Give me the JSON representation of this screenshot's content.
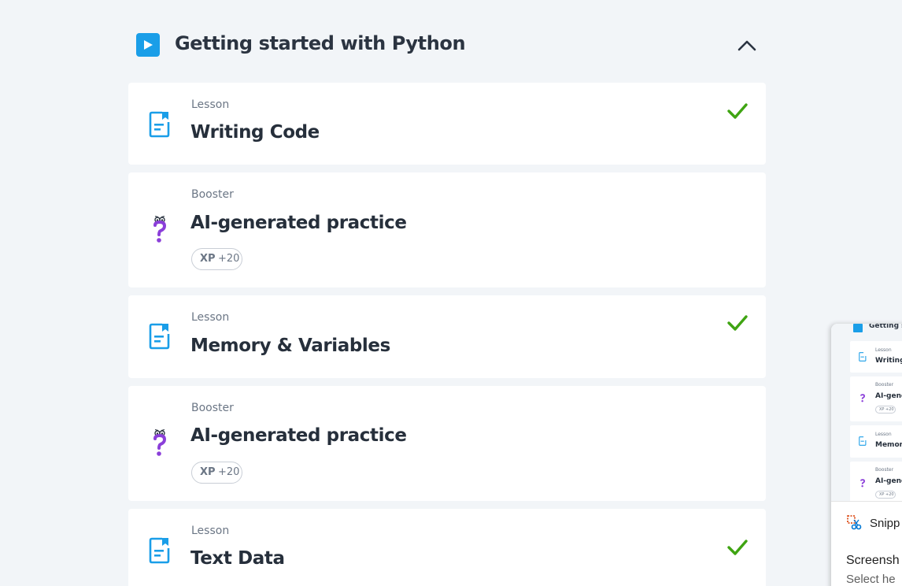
{
  "section": {
    "title": "Getting started with Python",
    "collapse_icon": "chevron-up-icon",
    "play_icon": "play-icon",
    "accent_color": "#1a9ee8"
  },
  "items": [
    {
      "kind": "Lesson",
      "title": "Writing Code",
      "icon": "lesson-document-icon",
      "completed": true
    },
    {
      "kind": "Booster",
      "title": "AI-generated practice",
      "icon": "question-mark-character-icon",
      "xp_label": "XP",
      "xp_value": "+20"
    },
    {
      "kind": "Lesson",
      "title": "Memory & Variables",
      "icon": "lesson-document-icon",
      "completed": true
    },
    {
      "kind": "Booster",
      "title": "AI-generated practice",
      "icon": "question-mark-character-icon",
      "xp_label": "XP",
      "xp_value": "+20"
    },
    {
      "kind": "Lesson",
      "title": "Text Data",
      "icon": "lesson-document-icon",
      "completed": true
    }
  ],
  "colors": {
    "check": "#3fa412",
    "lesson_icon": "#1a9ee8",
    "booster_icon": "#8b3fd9",
    "background": "#f2f5f8"
  },
  "snip_overlay": {
    "thumbnail": {
      "header_title": "Getting st",
      "items": [
        {
          "kind": "Lesson",
          "title": "Writing"
        },
        {
          "kind": "Booster",
          "title": "AI-gene",
          "xp": "XP +20"
        },
        {
          "kind": "Lesson",
          "title": "Memory"
        },
        {
          "kind": "Booster",
          "title": "AI-gene",
          "xp": "XP +20"
        }
      ]
    },
    "app_name": "Snipp",
    "app_icon": "snipping-tool-icon",
    "heading": "Screensh",
    "subtext": "Select he"
  }
}
